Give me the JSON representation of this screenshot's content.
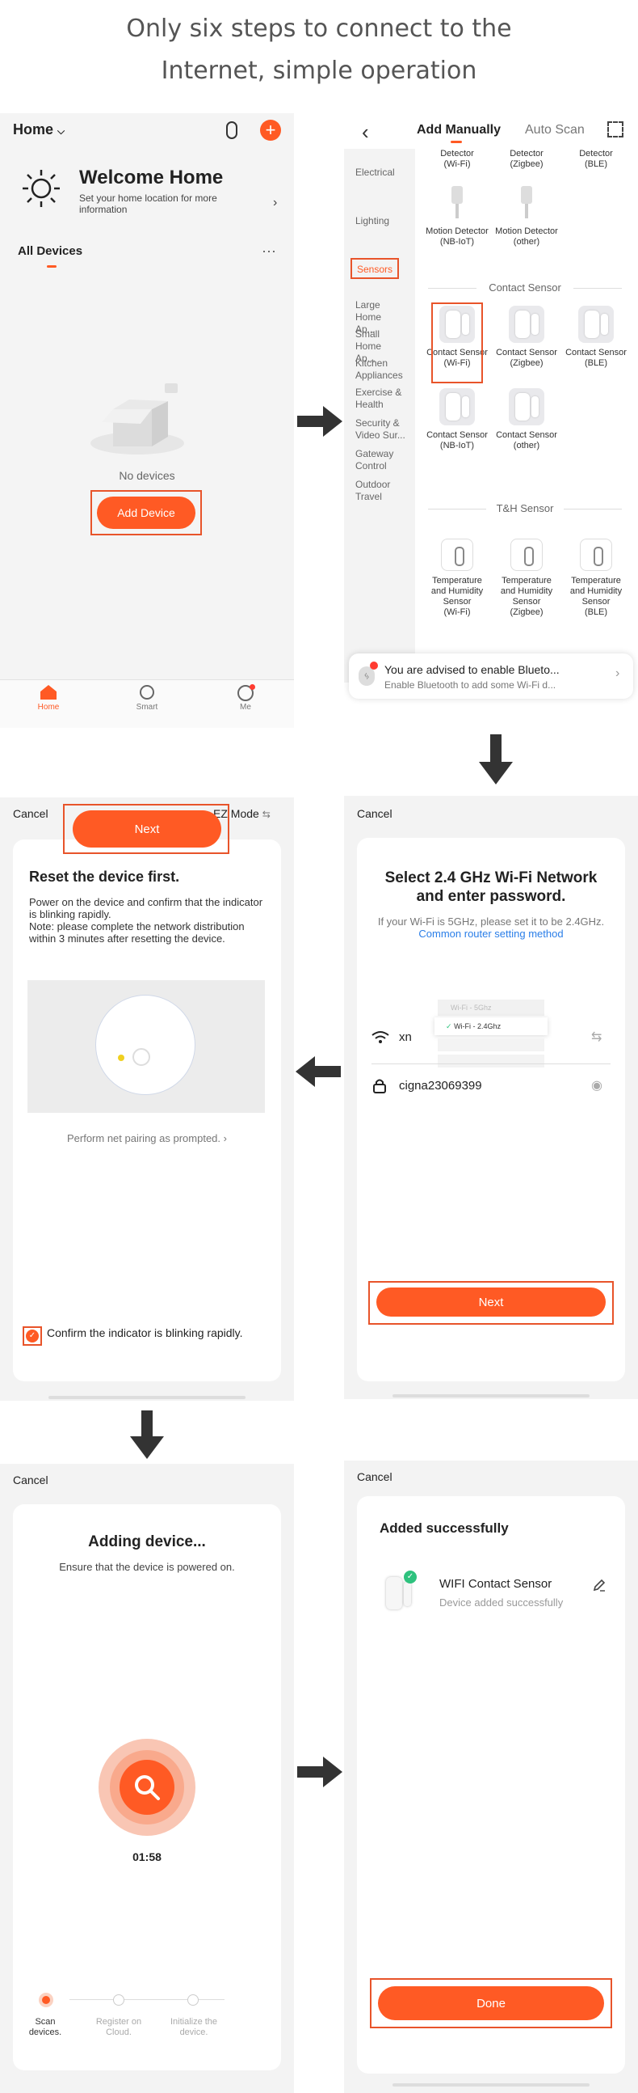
{
  "headline": {
    "line1": "Only six steps to connect to the",
    "line2": "Internet, simple operation"
  },
  "screen1": {
    "home_label": "Home",
    "welcome_title": "Welcome Home",
    "welcome_sub": "Set your home location for more information",
    "all_devices": "All Devices",
    "more": "···",
    "no_devices": "No devices",
    "add_device": "Add Device",
    "nav": [
      {
        "label": "Home"
      },
      {
        "label": "Smart"
      },
      {
        "label": "Me"
      }
    ]
  },
  "screen2": {
    "tab_manual": "Add Manually",
    "tab_auto": "Auto Scan",
    "categories": [
      "Electrical",
      "Lighting",
      "Sensors",
      "Large Home Ap...",
      "Small Home Ap...",
      "Kitchen Appliances",
      "Exercise & Health",
      "Security & Video Sur...",
      "Gateway Control",
      "Outdoor Travel"
    ],
    "top_items": [
      {
        "name": "Detector",
        "sub": "(Wi-Fi)"
      },
      {
        "name": "Detector",
        "sub": "(Zigbee)"
      },
      {
        "name": "Detector",
        "sub": "(BLE)"
      }
    ],
    "motion_items": [
      {
        "name": "Motion Detector",
        "sub": "(NB-IoT)"
      },
      {
        "name": "Motion Detector",
        "sub": "(other)"
      }
    ],
    "contact_section": "Contact Sensor",
    "contact_items": [
      {
        "name": "Contact Sensor",
        "sub": "(Wi-Fi)"
      },
      {
        "name": "Contact Sensor",
        "sub": "(Zigbee)"
      },
      {
        "name": "Contact Sensor",
        "sub": "(BLE)"
      },
      {
        "name": "Contact Sensor",
        "sub": "(NB-IoT)"
      },
      {
        "name": "Contact Sensor",
        "sub": "(other)"
      }
    ],
    "th_section": "T&H Sensor",
    "th_items": [
      {
        "name": "Temperature and Humidity Sensor",
        "sub": "(Wi-Fi)"
      },
      {
        "name": "Temperature and Humidity Sensor",
        "sub": "(Zigbee)"
      },
      {
        "name": "Temperature and Humidity Sensor",
        "sub": "(BLE)"
      }
    ],
    "bt_title": "You are advised to enable Blueto...",
    "bt_sub": "Enable Bluetooth to add some Wi-Fi d..."
  },
  "screen3": {
    "cancel": "Cancel",
    "mode": "EZ Mode",
    "title": "Reset the device first.",
    "desc": "Power on the device and confirm that the indicator is blinking rapidly.\nNote: please complete the network distribution within 3 minutes after resetting the device.",
    "prompt": "Perform net pairing as prompted.",
    "confirm": "Confirm the indicator is blinking rapidly.",
    "next": "Next"
  },
  "screen4": {
    "cancel": "Cancel",
    "title": "Select 2.4 GHz Wi-Fi Network and enter password.",
    "hint": "If your Wi-Fi is 5GHz, please set it to be 2.4GHz.",
    "hint_link": "Common router setting method",
    "wifi_5g": "Wi-Fi - 5Ghz",
    "wifi_24g": "Wi-Fi - 2.4Ghz",
    "ssid": "xn",
    "password": "cigna23069399",
    "next": "Next"
  },
  "screen5": {
    "cancel": "Cancel",
    "title": "Adding device...",
    "sub": "Ensure that the device is powered on.",
    "timer": "01:58",
    "steps": [
      {
        "label": "Scan devices."
      },
      {
        "label": "Register on Cloud."
      },
      {
        "label": "Initialize the device."
      }
    ]
  },
  "screen6": {
    "cancel": "Cancel",
    "title": "Added successfully",
    "device_name": "WIFI Contact Sensor",
    "device_status": "Device added successfully",
    "done": "Done"
  },
  "colors": {
    "accent": "#ff5a24",
    "highlight": "#e8542a",
    "link": "#2a7ee8",
    "success": "#2ec27e"
  }
}
